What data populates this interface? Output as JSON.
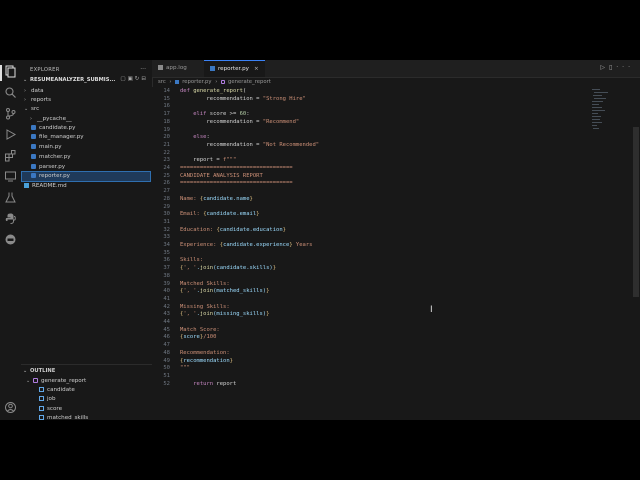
{
  "sidebar": {
    "title": "EXPLORER",
    "project": "RESUMEANALYZER_SUBMIS...",
    "tree": [
      {
        "label": "data",
        "kind": "folder",
        "depth": 0
      },
      {
        "label": "reports",
        "kind": "folder",
        "depth": 0
      },
      {
        "label": "src",
        "kind": "folder-open",
        "depth": 0
      },
      {
        "label": "__pycache__",
        "kind": "folder",
        "depth": 1
      },
      {
        "label": "candidate.py",
        "kind": "py",
        "depth": 1
      },
      {
        "label": "file_manager.py",
        "kind": "py",
        "depth": 1
      },
      {
        "label": "main.py",
        "kind": "py",
        "depth": 1
      },
      {
        "label": "matcher.py",
        "kind": "py",
        "depth": 1
      },
      {
        "label": "parser.py",
        "kind": "py",
        "depth": 1
      },
      {
        "label": "reporter.py",
        "kind": "py",
        "depth": 1,
        "selected": true
      },
      {
        "label": "README.md",
        "kind": "md",
        "depth": 0
      }
    ],
    "outline_title": "OUTLINE",
    "outline": [
      {
        "label": "generate_report",
        "kind": "function",
        "depth": 0
      },
      {
        "label": "candidate",
        "kind": "var",
        "depth": 1
      },
      {
        "label": "job",
        "kind": "var",
        "depth": 1
      },
      {
        "label": "score",
        "kind": "var",
        "depth": 1
      },
      {
        "label": "matched_skills",
        "kind": "var",
        "depth": 1
      }
    ]
  },
  "tabs": [
    {
      "label": "app.log",
      "active": false
    },
    {
      "label": "reporter.py",
      "active": true,
      "close": "×"
    }
  ],
  "breadcrumb": [
    "src",
    "reporter.py",
    "generate_report"
  ],
  "editor": {
    "lines": [
      {
        "n": "14",
        "code": "def generate_report("
      },
      {
        "n": "15",
        "code": "        recommendation = \"Strong Hire\""
      },
      {
        "n": "16",
        "code": ""
      },
      {
        "n": "17",
        "code": "    elif score >= 60:"
      },
      {
        "n": "18",
        "code": "        recommendation = \"Recommend\""
      },
      {
        "n": "19",
        "code": ""
      },
      {
        "n": "20",
        "code": "    else:"
      },
      {
        "n": "21",
        "code": "        recommendation = \"Not Recommended\""
      },
      {
        "n": "22",
        "code": ""
      },
      {
        "n": "23",
        "code": "    report = f\"\"\""
      },
      {
        "n": "24",
        "code": "=================================="
      },
      {
        "n": "25",
        "code": "CANDIDATE ANALYSIS REPORT"
      },
      {
        "n": "26",
        "code": "=================================="
      },
      {
        "n": "27",
        "code": ""
      },
      {
        "n": "28",
        "code": "Name: {candidate.name}"
      },
      {
        "n": "29",
        "code": ""
      },
      {
        "n": "30",
        "code": "Email: {candidate.email}"
      },
      {
        "n": "31",
        "code": ""
      },
      {
        "n": "32",
        "code": "Education: {candidate.education}"
      },
      {
        "n": "33",
        "code": ""
      },
      {
        "n": "34",
        "code": "Experience: {candidate.experience} Years"
      },
      {
        "n": "35",
        "code": ""
      },
      {
        "n": "36",
        "code": "Skills:"
      },
      {
        "n": "37",
        "code": "{', '.join(candidate.skills)}"
      },
      {
        "n": "38",
        "code": ""
      },
      {
        "n": "39",
        "code": "Matched Skills:"
      },
      {
        "n": "40",
        "code": "{', '.join(matched_skills)}"
      },
      {
        "n": "41",
        "code": ""
      },
      {
        "n": "42",
        "code": "Missing Skills:"
      },
      {
        "n": "43",
        "code": "{', '.join(missing_skills)}"
      },
      {
        "n": "44",
        "code": ""
      },
      {
        "n": "45",
        "code": "Match Score:"
      },
      {
        "n": "46",
        "code": "{score}/100"
      },
      {
        "n": "47",
        "code": ""
      },
      {
        "n": "48",
        "code": "Recommendation:"
      },
      {
        "n": "49",
        "code": "{recommendation}"
      },
      {
        "n": "50",
        "code": "\"\"\""
      },
      {
        "n": "51",
        "code": ""
      },
      {
        "n": "52",
        "code": "    return report"
      }
    ]
  },
  "colors": {
    "accent": "#3b82f6",
    "background": "#181818",
    "selection": "#1f3a5a"
  },
  "icons": [
    "explorer-icon",
    "search-icon",
    "source-control-icon",
    "run-debug-icon",
    "extensions-icon",
    "remote-icon",
    "testing-icon",
    "python-icon",
    "docker-icon",
    "account-icon",
    "gear-icon"
  ]
}
